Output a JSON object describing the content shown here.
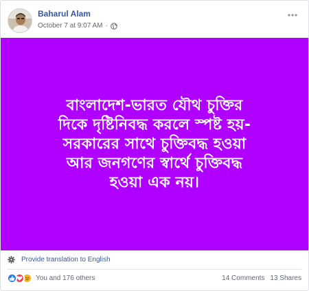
{
  "post": {
    "author": "Baharul Alam",
    "date": "October 7 at 9:07 AM",
    "separator": "·",
    "privacy_icon": "globe-icon",
    "menu_icon": "more-options-icon"
  },
  "banner": {
    "background": "#b000ff",
    "text": "বাংলাদেশ-ভারত যৌথ চুক্তির\nদিকে দৃষ্টিনিবদ্ধ করলে স্পষ্ট হয়-\nসরকারের সাথে চুক্তিবদ্ধ হওয়া\nআর জনগণের স্বার্থে চুক্তিবদ্ধ\nহওয়া এক নয়।"
  },
  "translation": {
    "label": "Provide translation to English",
    "icon": "gear-icon"
  },
  "footer": {
    "reactions": [
      "like-icon",
      "love-icon",
      "sad-icon"
    ],
    "reactions_text": "You and 176 others",
    "comments": "14 Comments",
    "shares": "13 Shares"
  },
  "colors": {
    "link": "#385898",
    "meta": "#616770",
    "like": "#2078f4",
    "love": "#f33e58",
    "sad": "#f7b125"
  }
}
